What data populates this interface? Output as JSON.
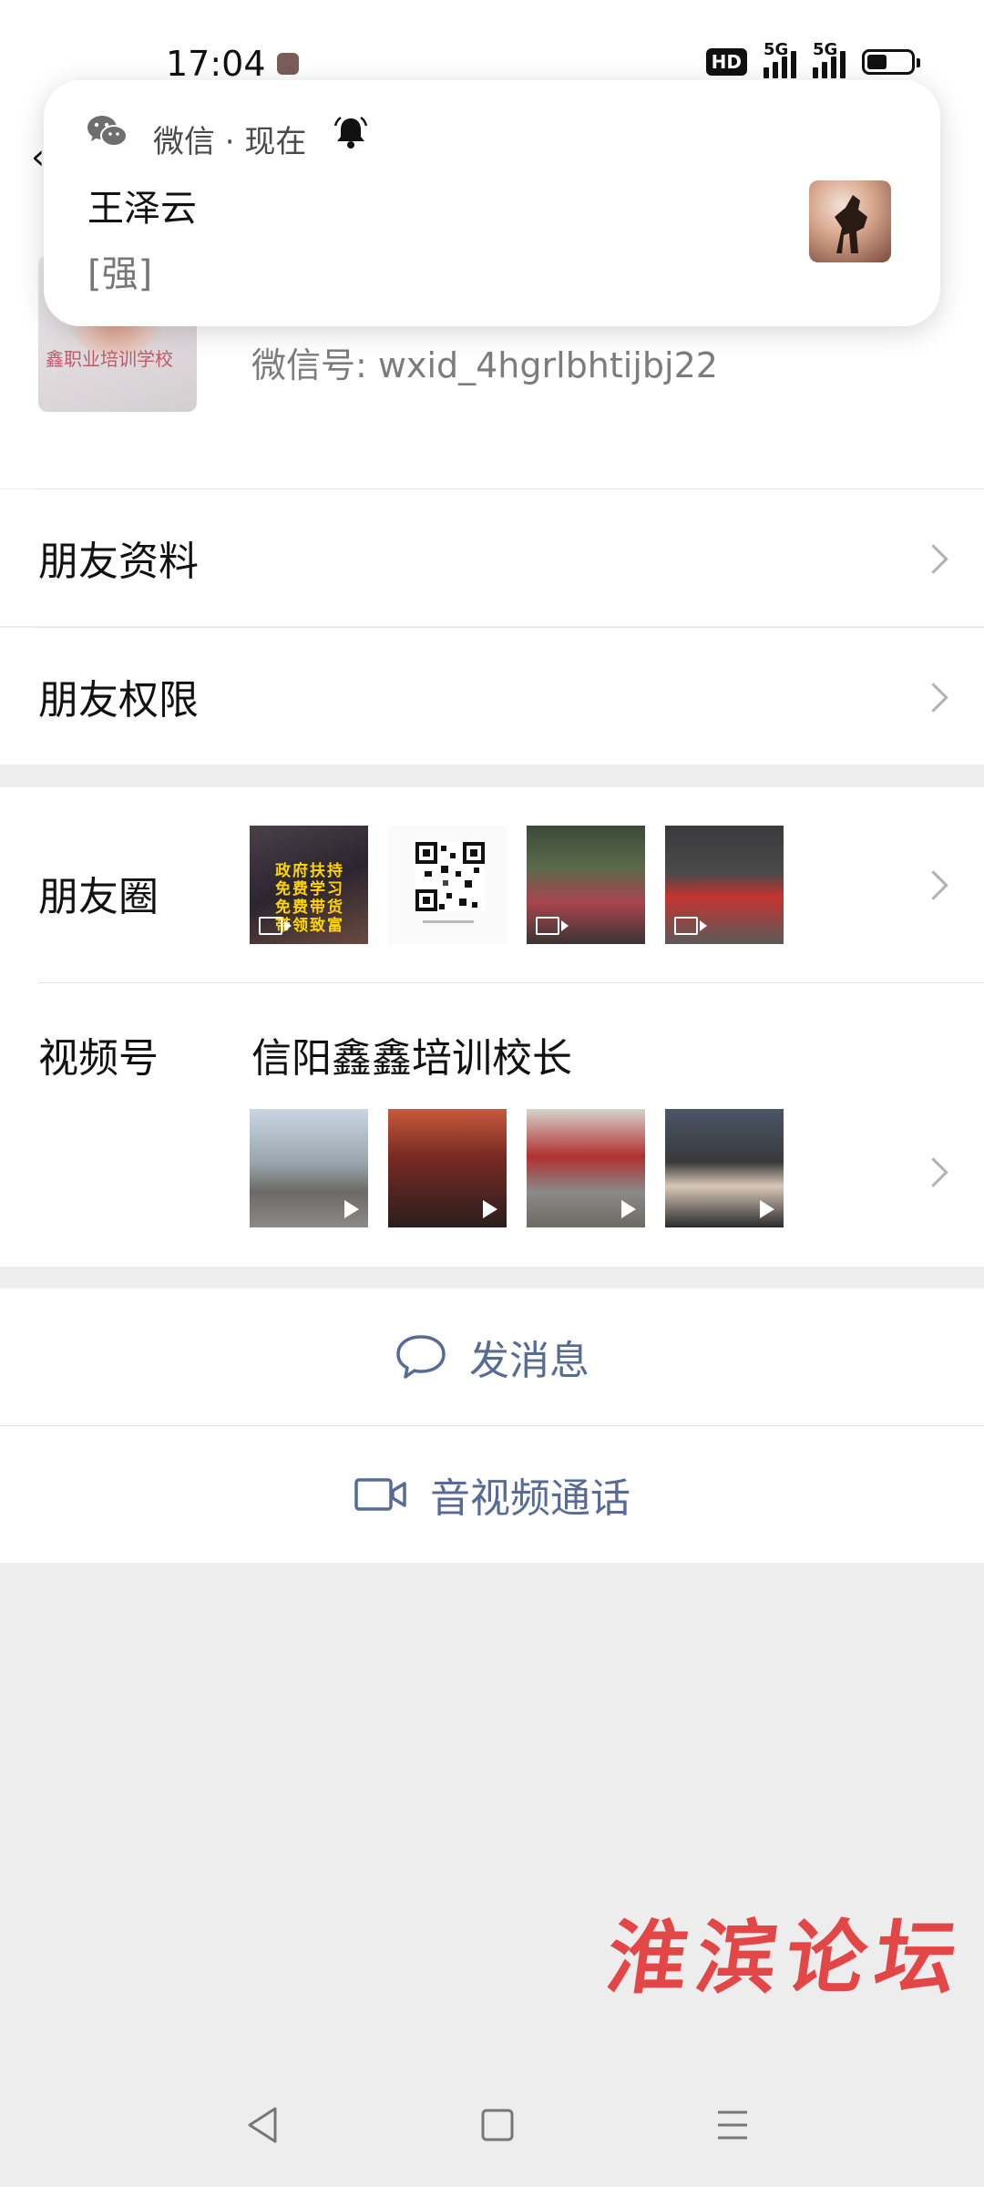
{
  "status_bar": {
    "time": "17:04",
    "hd_badge": "HD",
    "signal_1_label": "5G",
    "signal_2_label": "5G",
    "battery_level": 0.45
  },
  "notification": {
    "app_name": "微信 · 现在",
    "sender": "王泽云",
    "message": "[强]"
  },
  "profile": {
    "avatar_caption": "鑫职业培训学校",
    "wechat_id": "微信号:  wxid_4hgrlbhtijbj22"
  },
  "menu": {
    "friend_info": "朋友资料",
    "friend_permissions": "朋友权限"
  },
  "moments": {
    "label": "朋友圈",
    "first_thumb_text": "政府扶持\n免费学习\n免费带货\n带领致富"
  },
  "channels": {
    "label": "视频号",
    "name": "信阳鑫鑫培训校长"
  },
  "actions": {
    "send_message": "发消息",
    "av_call": "音视频通话"
  },
  "watermark": "淮滨论坛",
  "colors": {
    "accent_link": "#576b95",
    "background": "#ededed",
    "watermark": "#e23838"
  }
}
